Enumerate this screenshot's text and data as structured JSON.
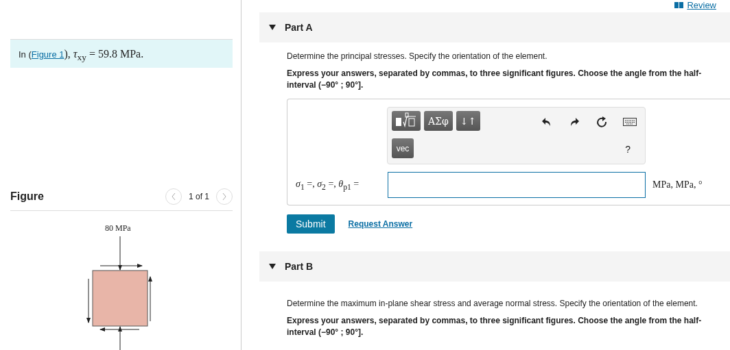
{
  "review_link": "Review",
  "intro": {
    "prefix": "In (",
    "link": "Figure 1",
    "suffix": "), *τ*$_{xy}$ = 59.8 MPa."
  },
  "figure": {
    "title": "Figure",
    "pager": "1 of 1",
    "label": "80 MPa"
  },
  "parts": [
    {
      "title": "Part A",
      "expanded": true,
      "prompt": "Determine the principal stresses. Specify the orientation of the element.",
      "instructions": "Express your answers, separated by commas, to three significant figures. Choose the angle from the half-interval (−90° ; 90°].",
      "answer": {
        "toolbar": [
          "ΑΣφ",
          "↓↑"
        ],
        "vec": "vec",
        "help": "?",
        "label": "*σ*$_{1}$ =, *σ*$_{2}$ =, *θ*$_{p1}$ =",
        "units": "MPa, MPa, °",
        "submit": "Submit",
        "request": "Request Answer"
      }
    },
    {
      "title": "Part B",
      "expanded": true,
      "prompt": "Determine the maximum in-plane shear stress and average normal stress. Specify the orientation of the element.",
      "instructions": "Express your answers, separated by commas, to three significant figures. Choose the angle from the half-interval (−90° ; 90°]."
    }
  ]
}
